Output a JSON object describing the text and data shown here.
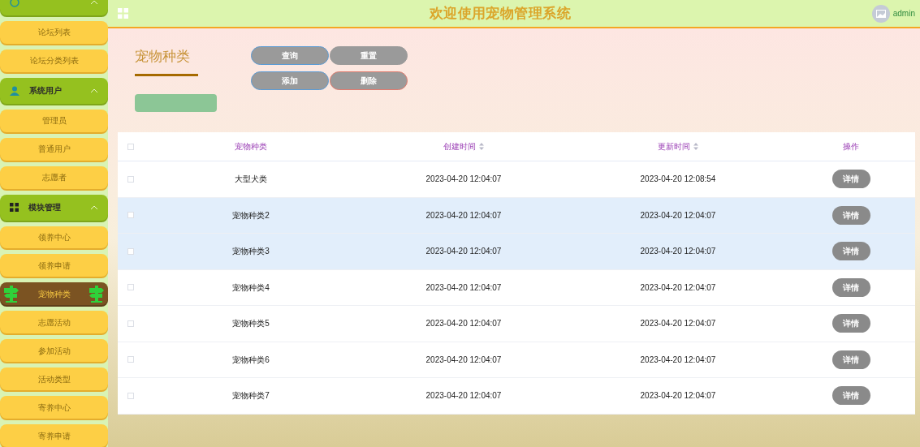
{
  "header": {
    "title": "欢迎使用宠物管理系统",
    "user": "admin"
  },
  "sidebar": {
    "groups": [
      {
        "expanded": true,
        "items": [
          {
            "label": "论坛列表",
            "selected": false
          },
          {
            "label": "论坛分类列表",
            "selected": false
          }
        ]
      },
      {
        "label": "系统用户",
        "expanded": true,
        "items": [
          {
            "label": "管理员",
            "selected": false
          },
          {
            "label": "普通用户",
            "selected": false
          },
          {
            "label": "志愿者",
            "selected": false
          }
        ]
      },
      {
        "label": "模块管理",
        "expanded": true,
        "items": [
          {
            "label": "领养中心",
            "selected": false
          },
          {
            "label": "领养申请",
            "selected": false
          },
          {
            "label": "宠物种类",
            "selected": true
          },
          {
            "label": "志愿活动",
            "selected": false
          },
          {
            "label": "参加活动",
            "selected": false
          },
          {
            "label": "活动类型",
            "selected": false
          },
          {
            "label": "寄养中心",
            "selected": false
          },
          {
            "label": "寄养申请",
            "selected": false
          }
        ]
      }
    ]
  },
  "page": {
    "title": "宠物种类",
    "buttons": [
      {
        "label": "查询",
        "kind": "primary"
      },
      {
        "label": "重置",
        "kind": "plain"
      },
      {
        "label": "添加",
        "kind": "primary"
      },
      {
        "label": "删除",
        "kind": "danger"
      }
    ]
  },
  "table": {
    "all_checked": false,
    "columns": [
      {
        "label": "宠物种类",
        "sortable": false
      },
      {
        "label": "创建时间",
        "sortable": true
      },
      {
        "label": "更新时间",
        "sortable": true
      },
      {
        "label": "操作",
        "sortable": false
      }
    ],
    "rows": [
      {
        "checked": false,
        "highlighted": false,
        "name": "大型犬类",
        "created": "2023-04-20 12:04:07",
        "updated": "2023-04-20 12:08:54",
        "action": "详情"
      },
      {
        "checked": false,
        "highlighted": true,
        "name": "宠物种类2",
        "created": "2023-04-20 12:04:07",
        "updated": "2023-04-20 12:04:07",
        "action": "详情"
      },
      {
        "checked": false,
        "highlighted": true,
        "name": "宠物种类3",
        "created": "2023-04-20 12:04:07",
        "updated": "2023-04-20 12:04:07",
        "action": "详情"
      },
      {
        "checked": false,
        "highlighted": false,
        "name": "宠物种类4",
        "created": "2023-04-20 12:04:07",
        "updated": "2023-04-20 12:04:07",
        "action": "详情"
      },
      {
        "checked": false,
        "highlighted": false,
        "name": "宠物种类5",
        "created": "2023-04-20 12:04:07",
        "updated": "2023-04-20 12:04:07",
        "action": "详情"
      },
      {
        "checked": false,
        "highlighted": false,
        "name": "宠物种类6",
        "created": "2023-04-20 12:04:07",
        "updated": "2023-04-20 12:04:07",
        "action": "详情"
      },
      {
        "checked": false,
        "highlighted": false,
        "name": "宠物种类7",
        "created": "2023-04-20 12:04:07",
        "updated": "2023-04-20 12:04:07",
        "action": "详情"
      }
    ]
  }
}
